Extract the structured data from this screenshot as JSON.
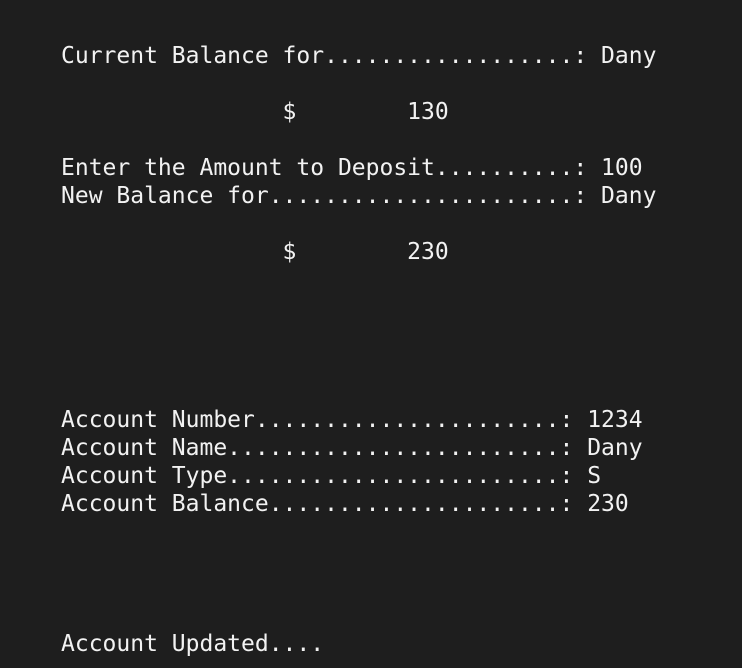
{
  "terminal": {
    "lines": {
      "current_balance_for": "Current Balance for..................: Dany",
      "old_balance": "                $        130",
      "enter_amount": "Enter the Amount to Deposit..........: 100",
      "new_balance_for": "New Balance for......................: Dany",
      "new_balance": "                $        230",
      "account_number": "Account Number......................: 1234",
      "account_name": "Account Name........................: Dany",
      "account_type": "Account Type........................: S",
      "account_balance": "Account Balance.....................: 230",
      "account_updated": "Account Updated...."
    }
  }
}
